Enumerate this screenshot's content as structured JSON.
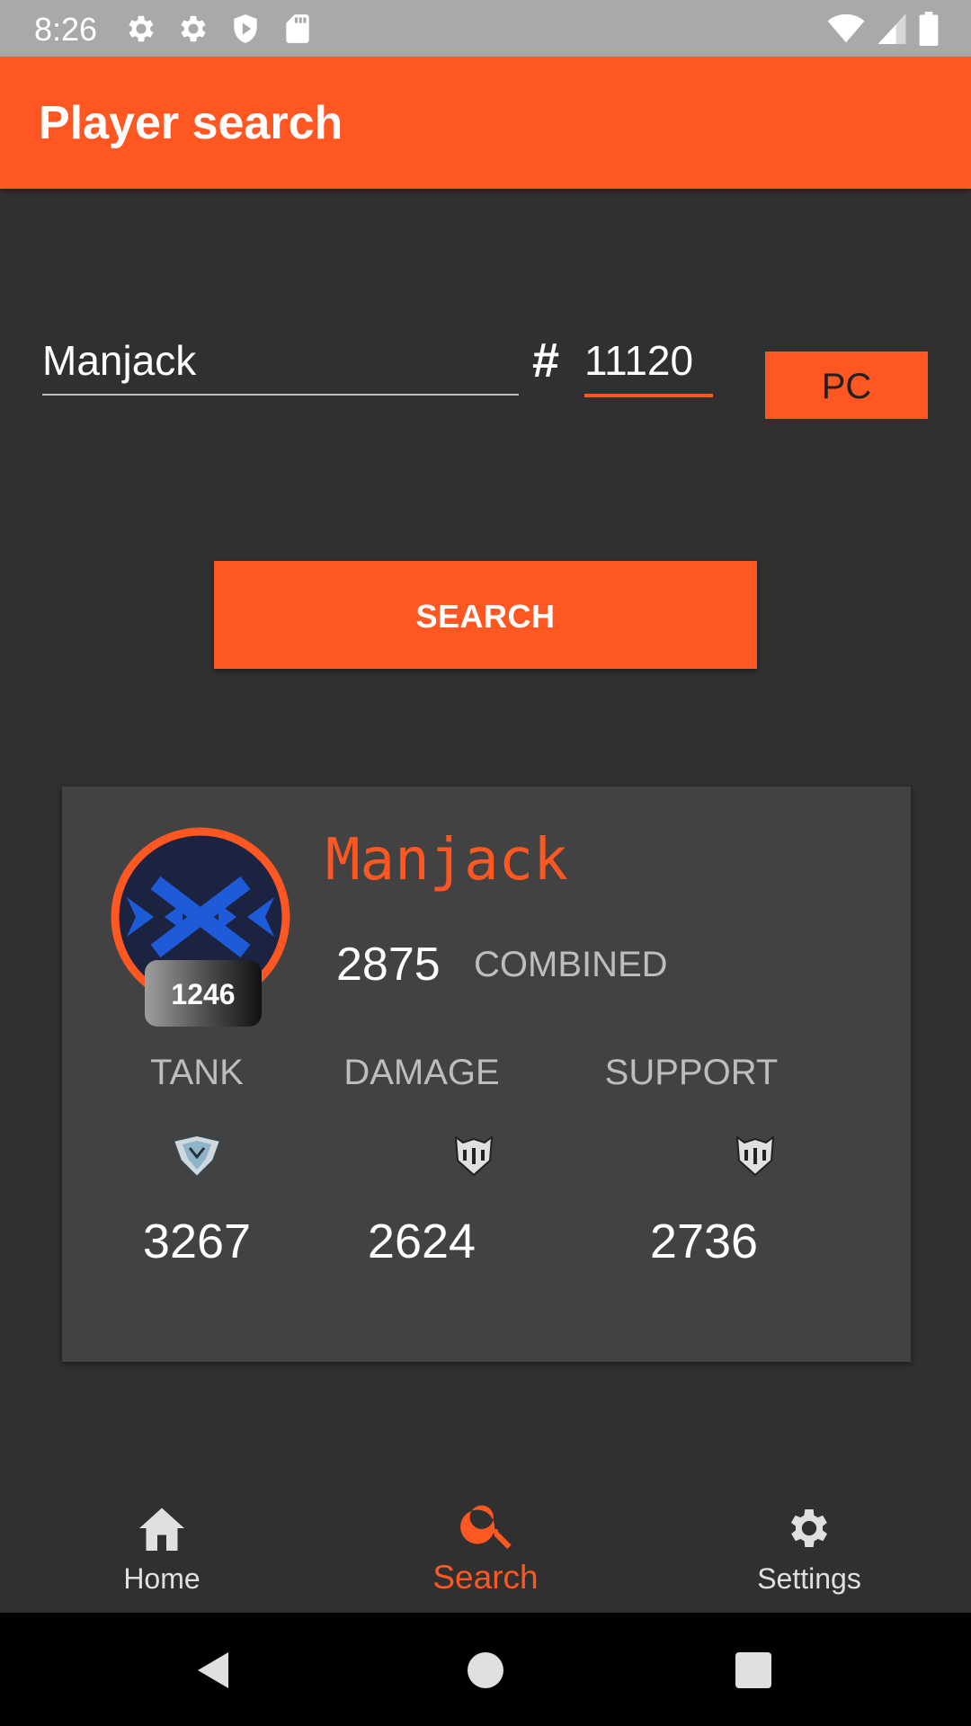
{
  "status_bar": {
    "time": "8:26",
    "left_icons": [
      "gear-icon",
      "gear-icon",
      "shield-icon",
      "sd-card-icon"
    ],
    "right_icons": [
      "wifi-icon",
      "signal-icon",
      "battery-icon"
    ]
  },
  "app_bar": {
    "title": "Player search"
  },
  "search_form": {
    "name_value": "Manjack",
    "hash": "#",
    "tag_value": "11120",
    "platform_label": "PC",
    "search_label": "SEARCH"
  },
  "player": {
    "name": "Manjack",
    "level": "1246",
    "combined_sr": "2875",
    "combined_label": "COMBINED",
    "roles": [
      {
        "label": "TANK",
        "sr": "3267",
        "icon": "platinum-rank-icon"
      },
      {
        "label": "DAMAGE",
        "sr": "2624",
        "icon": "gold-rank-icon"
      },
      {
        "label": "SUPPORT",
        "sr": "2736",
        "icon": "gold-rank-icon"
      }
    ]
  },
  "bottom_nav": {
    "items": [
      {
        "label": "Home",
        "icon": "home-icon"
      },
      {
        "label": "Search",
        "icon": "search-icon",
        "active": true
      },
      {
        "label": "Settings",
        "icon": "gear-icon"
      }
    ]
  },
  "colors": {
    "accent": "#ff5722",
    "background": "#303030",
    "card": "#424242",
    "avatar_blue": "#1e5bd8",
    "avatar_navy": "#1b2340"
  }
}
